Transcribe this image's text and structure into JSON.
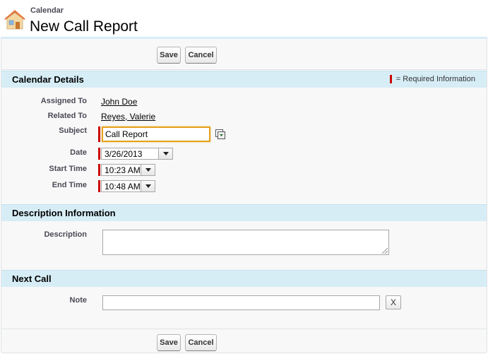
{
  "header": {
    "breadcrumb": "Calendar",
    "title": "New Call Report"
  },
  "buttons": {
    "save": "Save",
    "cancel": "Cancel"
  },
  "sections": {
    "calendar_details": "Calendar Details",
    "required_legend": "= Required Information",
    "description_info": "Description Information",
    "next_call": "Next Call"
  },
  "fields": {
    "assigned_to": {
      "label": "Assigned To",
      "value": "John Doe"
    },
    "related_to": {
      "label": "Related To",
      "value": "Reyes, Valerie"
    },
    "subject": {
      "label": "Subject",
      "value": "Call Report"
    },
    "date": {
      "label": "Date",
      "value": "3/26/2013"
    },
    "start_time": {
      "label": "Start Time",
      "value": "10:23 AM"
    },
    "end_time": {
      "label": "End Time",
      "value": "10:48 AM"
    },
    "description": {
      "label": "Description",
      "value": ""
    },
    "note": {
      "label": "Note",
      "value": "",
      "clear_label": "X"
    }
  },
  "colors": {
    "section_bg": "#d7edf6",
    "required": "#cc0000",
    "focus": "#e3a21a"
  }
}
